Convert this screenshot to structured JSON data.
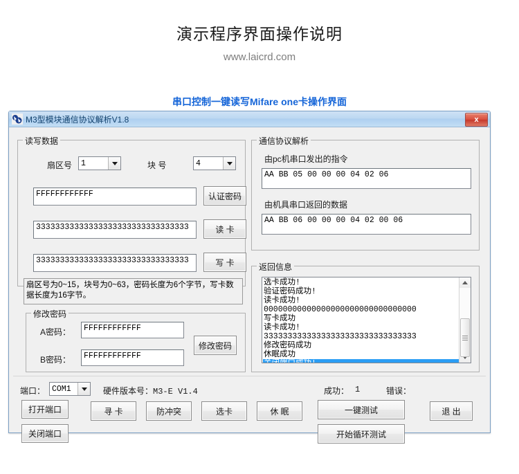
{
  "page": {
    "title": "演示程序界面操作说明",
    "subtitle": "www.laicrd.com",
    "section_caption": "串口控制一键读写Mifare one卡操作界面",
    "caption_color": "#1565d8"
  },
  "window": {
    "title": "M3型模块通信协议解析V1.8",
    "close_label": "x",
    "titlebar_color": "#bcd8f1",
    "background": "#f0f0f0"
  },
  "read_write_group": {
    "legend": "读写数据",
    "sector_label": "扇区号",
    "sector_value": "1",
    "block_label": "块 号",
    "block_value": "4",
    "password_value": "FFFFFFFFFFFF",
    "auth_button": "认证密码",
    "read_data_value": "33333333333333333333333333333333",
    "read_button": "读 卡",
    "write_data_value": "33333333333333333333333333333333",
    "write_button": "写 卡",
    "hint": "扇区号为0~15，块号为0~63，密码长度为6个字节，写卡数据长度为16字节。"
  },
  "modify_password_group": {
    "legend": "修改密码",
    "a_label": "A密码：",
    "a_value": "FFFFFFFFFFFF",
    "b_label": "B密码：",
    "b_value": "FFFFFFFFFFFF",
    "button": "修改密码"
  },
  "protocol_group": {
    "legend": "通信协议解析",
    "sent_label": "由pc机串口发出的指令",
    "sent_value": "AA BB 05 00 00 00 04 02 06",
    "recv_label": "由机具串口返回的数据",
    "recv_value": "AA BB 06 00 00 00 04 02 00 06"
  },
  "return_info_group": {
    "legend": "返回信息",
    "items": [
      {
        "text": "选卡成功!",
        "selected": false
      },
      {
        "text": "验证密码成功!",
        "selected": false
      },
      {
        "text": "读卡成功!",
        "selected": false
      },
      {
        "text": "00000000000000000000000000000000",
        "selected": false
      },
      {
        "text": "写卡成功",
        "selected": false
      },
      {
        "text": "读卡成功!",
        "selected": false
      },
      {
        "text": "33333333333333333333333333333333",
        "selected": false
      },
      {
        "text": "修改密码成功",
        "selected": false
      },
      {
        "text": "休眠成功",
        "selected": false
      },
      {
        "text": "关闭端口成功!",
        "selected": true
      }
    ],
    "selection_color": "#2a9df4"
  },
  "bottom_bar": {
    "port_label": "端口：",
    "port_value": "COM1",
    "hw_version_label": "硬件版本号：M3-E V1.4",
    "success_label": "成功：",
    "success_value": "1",
    "error_label": "错误：",
    "error_value": "",
    "buttons": {
      "open_port": "打开端口",
      "close_port": "关闭端口",
      "find_card": "寻 卡",
      "anticollision": "防冲突",
      "select_card": "选卡",
      "sleep": "休 眠",
      "one_key_test": "一键测试",
      "loop_test": "开始循环测试",
      "exit": "退 出"
    }
  }
}
